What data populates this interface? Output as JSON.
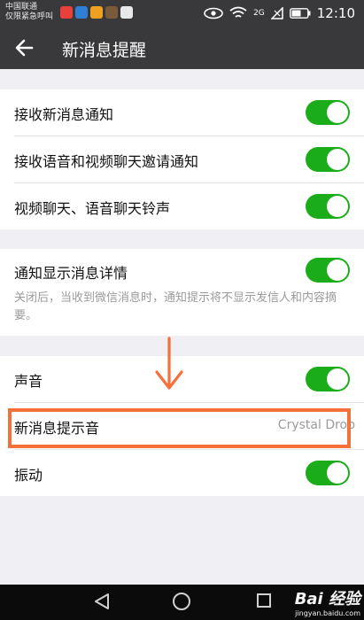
{
  "status_bar": {
    "carrier_line1": "中国联通",
    "carrier_line2": "仅限紧急呼叫",
    "network": "2G",
    "time": "12:10"
  },
  "toolbar": {
    "title": "新消息提醒",
    "back_icon": "arrow-left-icon"
  },
  "groups": [
    {
      "rows": [
        {
          "label": "接收新消息通知",
          "toggle": true
        },
        {
          "label": "接收语音和视频聊天邀请通知",
          "toggle": true
        },
        {
          "label": "视频聊天、语音聊天铃声",
          "toggle": true
        }
      ]
    },
    {
      "rows": [
        {
          "label": "通知显示消息详情",
          "toggle": true,
          "description": "关闭后，当收到微信消息时，通知提示将不显示发信人和内容摘要。"
        }
      ]
    },
    {
      "rows": [
        {
          "label": "声音",
          "toggle": true
        },
        {
          "label": "新消息提示音",
          "value": "Crystal Drop"
        },
        {
          "label": "振动",
          "toggle": true
        }
      ]
    }
  ],
  "colors": {
    "toolbar": "#39393b",
    "toggle_on": "#1aad19",
    "highlight": "#f5703b",
    "background": "#efeff4"
  },
  "watermark": {
    "brand": "Bai 经验",
    "url": "jingyan.baidu.com"
  }
}
